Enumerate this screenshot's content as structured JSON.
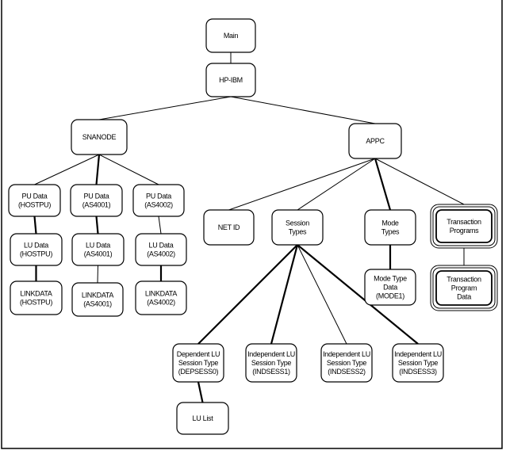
{
  "nodes": [
    {
      "id": "main",
      "lines": [
        "Main"
      ]
    },
    {
      "id": "hpibm",
      "lines": [
        "HP-IBM"
      ]
    },
    {
      "id": "snanode",
      "lines": [
        "SNANODE"
      ]
    },
    {
      "id": "appc",
      "lines": [
        "APPC"
      ]
    },
    {
      "id": "pu_hostpu",
      "lines": [
        "PU Data",
        "(HOSTPU)"
      ]
    },
    {
      "id": "pu_as4001",
      "lines": [
        "PU Data",
        "(AS4001)"
      ]
    },
    {
      "id": "pu_as4002",
      "lines": [
        "PU Data",
        "(AS4002)"
      ]
    },
    {
      "id": "lu_hostpu",
      "lines": [
        "LU Data",
        "(HOSTPU)"
      ]
    },
    {
      "id": "lu_as4001",
      "lines": [
        "LU Data",
        "(AS4001)"
      ]
    },
    {
      "id": "lu_as4002",
      "lines": [
        "LU Data",
        "(AS4002)"
      ]
    },
    {
      "id": "link_hostpu",
      "lines": [
        "LINKDATA",
        "(HOSTPU)"
      ]
    },
    {
      "id": "link_as4001",
      "lines": [
        "LINKDATA",
        "(AS4001)"
      ]
    },
    {
      "id": "link_as4002",
      "lines": [
        "LINKDATA",
        "(AS4002)"
      ]
    },
    {
      "id": "netid",
      "lines": [
        "NET ID"
      ]
    },
    {
      "id": "sesstypes",
      "lines": [
        "Session",
        "Types"
      ]
    },
    {
      "id": "modetypes",
      "lines": [
        "Mode",
        "Types"
      ]
    },
    {
      "id": "tps",
      "lines": [
        "Transaction",
        "Programs"
      ],
      "style": "triple"
    },
    {
      "id": "modedata",
      "lines": [
        "Mode Type",
        "Data",
        "(MODE1)"
      ]
    },
    {
      "id": "tpdata",
      "lines": [
        "Transaction",
        "Program",
        "Data"
      ],
      "style": "triple"
    },
    {
      "id": "depsess0",
      "lines": [
        "Dependent LU",
        "Session Type",
        "(DEPSESS0)"
      ]
    },
    {
      "id": "indsess1",
      "lines": [
        "Independent LU",
        "Session Type",
        "(INDSESS1)"
      ]
    },
    {
      "id": "indsess2",
      "lines": [
        "Independent LU",
        "Session Type",
        "(INDSESS2)"
      ]
    },
    {
      "id": "indsess3",
      "lines": [
        "Independent LU",
        "Session Type",
        "(INDSESS3)"
      ]
    },
    {
      "id": "lulist",
      "lines": [
        "LU List"
      ]
    }
  ],
  "edges": [
    [
      "main",
      "hpibm"
    ],
    [
      "hpibm",
      "snanode"
    ],
    [
      "hpibm",
      "appc"
    ],
    [
      "snanode",
      "pu_hostpu"
    ],
    [
      "snanode",
      "pu_as4001"
    ],
    [
      "snanode",
      "pu_as4002"
    ],
    [
      "pu_hostpu",
      "lu_hostpu"
    ],
    [
      "pu_as4001",
      "lu_as4001"
    ],
    [
      "pu_as4002",
      "lu_as4002"
    ],
    [
      "lu_hostpu",
      "link_hostpu"
    ],
    [
      "lu_as4001",
      "link_as4001"
    ],
    [
      "lu_as4002",
      "link_as4002"
    ],
    [
      "appc",
      "netid"
    ],
    [
      "appc",
      "sesstypes"
    ],
    [
      "appc",
      "modetypes"
    ],
    [
      "appc",
      "tps"
    ],
    [
      "modetypes",
      "modedata"
    ],
    [
      "tps",
      "tpdata"
    ],
    [
      "sesstypes",
      "depsess0"
    ],
    [
      "sesstypes",
      "indsess1"
    ],
    [
      "sesstypes",
      "indsess2"
    ],
    [
      "sesstypes",
      "indsess3"
    ],
    [
      "depsess0",
      "lulist"
    ]
  ]
}
